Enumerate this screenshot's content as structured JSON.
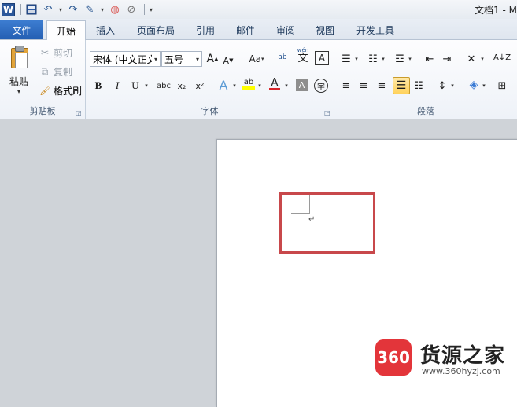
{
  "window": {
    "title": "文档1 - M"
  },
  "qat": {
    "word_logo": "W",
    "undo_icon": "↶",
    "redo_icon": "↷",
    "brush_icon": "✎",
    "color_icon": "◍",
    "noformat_icon": "⊘"
  },
  "tabs": {
    "file": "文件",
    "items": [
      {
        "label": "开始",
        "active": true
      },
      {
        "label": "插入"
      },
      {
        "label": "页面布局"
      },
      {
        "label": "引用"
      },
      {
        "label": "邮件"
      },
      {
        "label": "审阅"
      },
      {
        "label": "视图"
      },
      {
        "label": "开发工具"
      }
    ]
  },
  "clipboard": {
    "paste_label": "粘贴",
    "cut_label": "剪切",
    "copy_label": "复制",
    "format_painter_label": "格式刷",
    "group_label": "剪贴板"
  },
  "font": {
    "font_name": "宋体 (中文正文)",
    "font_size": "五号",
    "grow_label": "A",
    "shrink_label": "A",
    "change_case_label": "Aa",
    "clear_format_label": "ab",
    "phonetic_label": "wén",
    "phonetic_char": "文",
    "border_char": "A",
    "bold": "B",
    "italic": "I",
    "underline": "U",
    "strike": "abc",
    "subscript": "x₂",
    "superscript": "x²",
    "effects": "A",
    "highlight": "ab",
    "font_color": "A",
    "shading": "A",
    "enclose": "字",
    "group_label": "字体"
  },
  "paragraph": {
    "group_label": "段落",
    "sort_label": "A↓Z"
  },
  "document": {
    "paragraph_mark": "↵"
  },
  "watermark": {
    "logo_text": "360",
    "title": "货源之家",
    "url": "www.360hyzj.com"
  },
  "colors": {
    "accent": "#2b579a",
    "file_tab": "#2f6fc5",
    "highlight_box": "#c8484b",
    "watermark_red": "#e3353a"
  }
}
